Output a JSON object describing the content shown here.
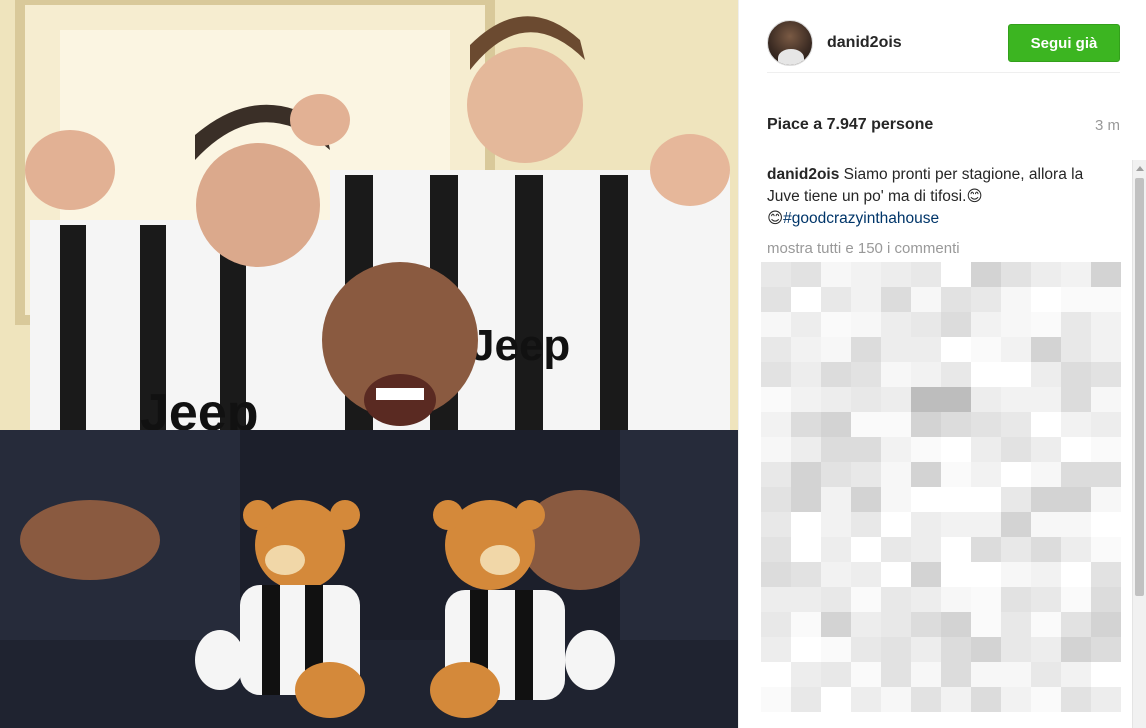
{
  "post": {
    "header": {
      "username": "danid2ois",
      "follow_label": "Segui già"
    },
    "likes_text": "Piace a 7.947 persone",
    "time_ago": "3 m",
    "caption": {
      "user": "danid2ois",
      "text": "Siamo pronti per stagione, allora la Juve tiene un po' ma di tifosi.",
      "emoji": "😊",
      "emoji2": "😊",
      "hashtag": "#goodcrazyinthahouse"
    },
    "show_comments_label": "mostra tutti e 150 i commenti"
  },
  "colors": {
    "follow_bg": "#3cb521",
    "hashtag": "#003569",
    "muted": "#999999"
  },
  "icons": {
    "avatar": "profile-photo",
    "scroll_up": "scroll-up-arrow"
  }
}
